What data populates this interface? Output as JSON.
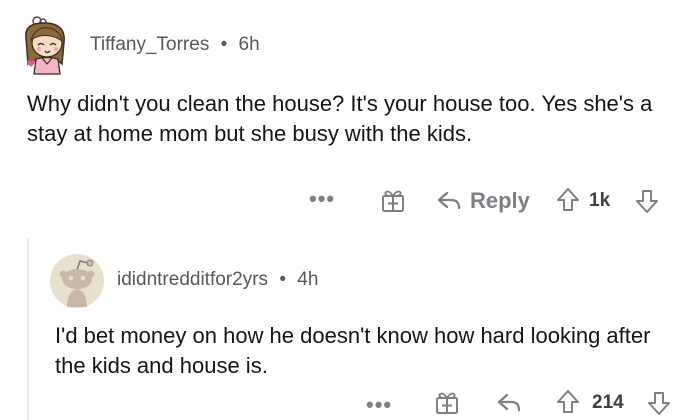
{
  "comments": [
    {
      "username": "Tiffany_Torres",
      "separator": "•",
      "time": "6h",
      "text": "Why didn't you clean the house? It's your house too. Yes she's a stay at home mom but she busy with the kids.",
      "actions": {
        "more": "•••",
        "reply_label": "Reply",
        "score": "1k"
      }
    },
    {
      "username": "ididntredditfor2yrs",
      "separator": "•",
      "time": "4h",
      "text": "I'd bet money on how he doesn't know how hard looking after the kids and house is.",
      "actions": {
        "more": "•••",
        "score": "214"
      }
    }
  ],
  "icons": {
    "avatar_1": "snoo-avatar-girl",
    "avatar_2": "snoo-avatar-default",
    "award": "gift-icon",
    "reply": "reply-arrow-icon",
    "upvote": "upvote-arrow-icon",
    "downvote": "downvote-arrow-icon"
  },
  "colors": {
    "meta_text": "#55585c",
    "action_gray": "#7c7f83",
    "body_text": "#151515",
    "thread_line": "#e8eaec"
  }
}
